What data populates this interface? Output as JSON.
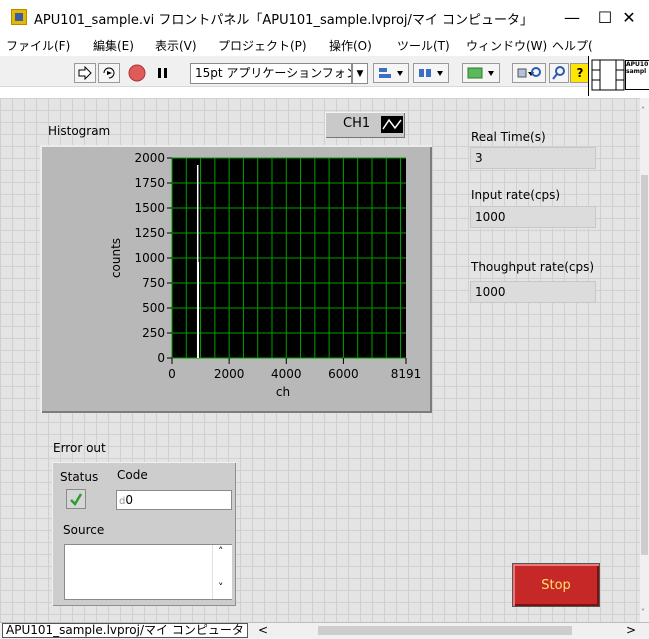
{
  "window": {
    "title": "APU101_sample.vi フロントパネル「APU101_sample.lvproj/マイ コンピュータ」",
    "minimize_glyph": "—",
    "maximize_glyph": "☐",
    "close_glyph": "✕"
  },
  "menu": {
    "items": [
      "ファイル(F)",
      "編集(E)",
      "表示(V)",
      "プロジェクト(P)",
      "操作(O)",
      "ツール(T)",
      "ウィンドウ(W)",
      "ヘルプ("
    ]
  },
  "toolbar": {
    "font_select_value": "15pt アプリケーションフォント",
    "icons": [
      "run-arrow-icon",
      "run-continuously-icon",
      "abort-icon",
      "pause-icon",
      "align-icon",
      "distribute-icon",
      "resize-icon",
      "reorder-icon",
      "search-icon",
      "context-help-icon"
    ],
    "vi_icon_text": "APU10 sampl"
  },
  "graph": {
    "label": "Histogram",
    "plot_legend": "CH1",
    "chart_data": {
      "type": "bar",
      "x": [
        900,
        920
      ],
      "values": [
        1930,
        960
      ],
      "xlabel": "ch",
      "ylabel": "counts",
      "xlim": [
        0,
        8191
      ],
      "ylim": [
        0,
        2000
      ],
      "x_ticks": [
        "0",
        "2000",
        "4000",
        "6000",
        "8191"
      ],
      "y_ticks": [
        "0",
        "250",
        "500",
        "750",
        "1000",
        "1250",
        "1500",
        "1750",
        "2000"
      ],
      "grid": true,
      "plot_background": "#000000",
      "grid_color": "#00a000",
      "trace_color": "#ffffff"
    }
  },
  "indicators": {
    "real_time": {
      "label": "Real Time(s)",
      "value": "3"
    },
    "input_rate": {
      "label": "Input rate(cps)",
      "value": "1000"
    },
    "throughput_rate": {
      "label": "Thoughput rate(cps)",
      "value": "1000"
    }
  },
  "error_out": {
    "label": "Error out",
    "status_label": "Status",
    "code_label": "Code",
    "code_radix": "d",
    "code_value": "0",
    "source_label": "Source"
  },
  "stop_button": {
    "label": "Stop"
  },
  "statusbar": {
    "path": "APU101_sample.lvproj/マイ コンピュータ",
    "scroll_left_glyph": "<",
    "scroll_right_glyph": ">"
  },
  "colors": {
    "panel_background": "#e4e4e4",
    "stop_button": "#c62828",
    "stop_text": "#ffe169",
    "status_check": "#2e9e2e"
  }
}
